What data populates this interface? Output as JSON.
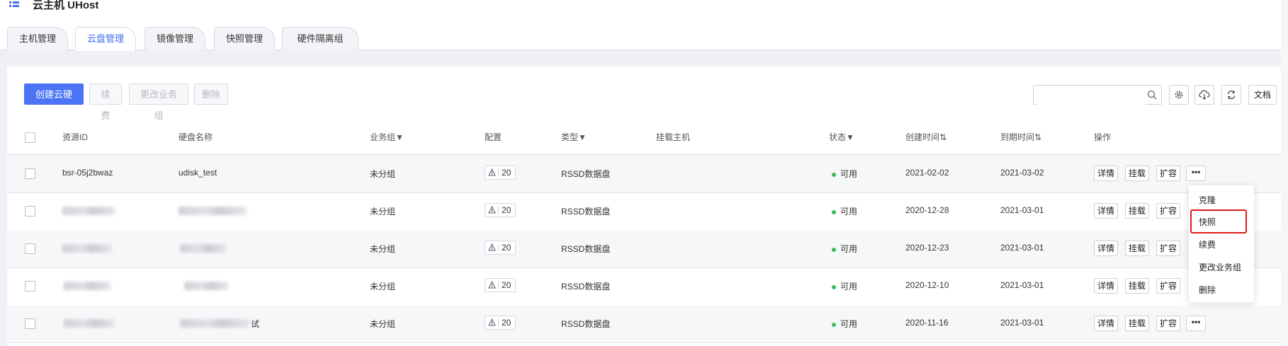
{
  "app": {
    "title": "云主机 UHost"
  },
  "tabs": [
    {
      "label": "主机管理"
    },
    {
      "label": "云盘管理"
    },
    {
      "label": "镜像管理"
    },
    {
      "label": "快照管理"
    },
    {
      "label": "硬件隔离组"
    }
  ],
  "toolbar": {
    "create_label": "创建云硬盘",
    "renew_label": "续费",
    "change_group_label": "更改业务组",
    "delete_label": "删除",
    "search_placeholder": "",
    "doc_label": "文档"
  },
  "table": {
    "headers": {
      "id": "资源ID",
      "name": "硬盘名称",
      "group": "业务组▼",
      "config": "配置",
      "type": "类型▼",
      "host": "挂载主机",
      "status": "状态▼",
      "created": "创建时间⇅",
      "expire": "到期时间⇅",
      "actions": "操作"
    },
    "rows": [
      {
        "id": "bsr-05j2bwaz",
        "name": "udisk_test",
        "name_suffix": "",
        "group": "未分组",
        "config": "20",
        "type": "RSSD数据盘",
        "status": "可用",
        "created": "2021-02-02",
        "expire": "2021-03-02"
      },
      {
        "id": "",
        "name": "",
        "name_suffix": "",
        "group": "未分组",
        "config": "20",
        "type": "RSSD数据盘",
        "status": "可用",
        "created": "2020-12-28",
        "expire": "2021-03-01"
      },
      {
        "id": "",
        "name": "",
        "name_suffix": "",
        "group": "未分组",
        "config": "20",
        "type": "RSSD数据盘",
        "status": "可用",
        "created": "2020-12-23",
        "expire": "2021-03-01"
      },
      {
        "id": "",
        "name": "",
        "name_suffix": "",
        "group": "未分组",
        "config": "20",
        "type": "RSSD数据盘",
        "status": "可用",
        "created": "2020-12-10",
        "expire": "2021-03-01"
      },
      {
        "id": "",
        "name": "",
        "name_suffix": "试",
        "group": "未分组",
        "config": "20",
        "type": "RSSD数据盘",
        "status": "可用",
        "created": "2020-11-16",
        "expire": "2021-03-01"
      }
    ],
    "action_labels": {
      "detail": "详情",
      "mount": "挂载",
      "expand": "扩容",
      "more": "•••"
    }
  },
  "more_menu": {
    "items": [
      {
        "label": "克隆"
      },
      {
        "label": "快照"
      },
      {
        "label": "续费"
      },
      {
        "label": "更改业务组"
      },
      {
        "label": "删除"
      }
    ],
    "highlighted": "快照"
  },
  "colors": {
    "primary": "#4a74f5",
    "status_ok": "#3dbb5f",
    "highlight": "#e01a1a"
  }
}
